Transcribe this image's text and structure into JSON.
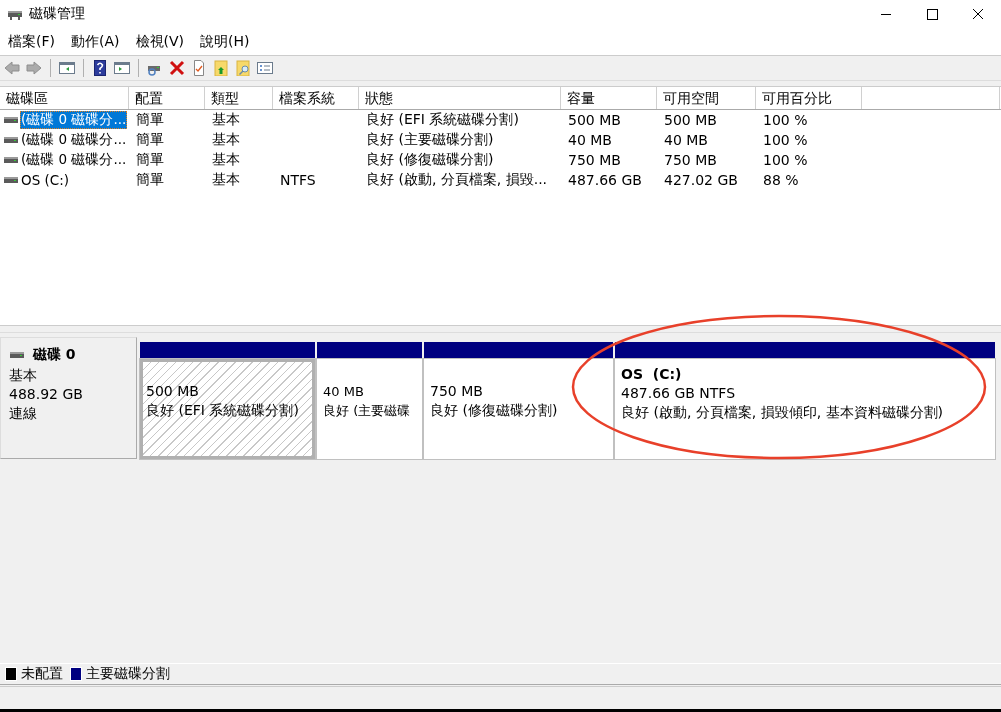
{
  "window": {
    "title": "磁碟管理"
  },
  "menu": [
    "檔案(F)",
    "動作(A)",
    "檢視(V)",
    "說明(H)"
  ],
  "toolbar": [
    {
      "kind": "back",
      "disabled": true
    },
    {
      "kind": "forward",
      "disabled": true
    },
    {
      "kind": "separator"
    },
    {
      "kind": "tree",
      "disabled": false
    },
    {
      "kind": "separator"
    },
    {
      "kind": "help",
      "disabled": false
    },
    {
      "kind": "pane",
      "disabled": false
    },
    {
      "kind": "separator"
    },
    {
      "kind": "drive",
      "disabled": false
    },
    {
      "kind": "delete",
      "disabled": false
    },
    {
      "kind": "properties",
      "disabled": false
    },
    {
      "kind": "folder_up",
      "disabled": false
    },
    {
      "kind": "folder_search",
      "disabled": false
    },
    {
      "kind": "checklist",
      "disabled": false
    }
  ],
  "table": {
    "columns": [
      "磁碟區",
      "配置",
      "類型",
      "檔案系統",
      "狀態",
      "容量",
      "可用空間",
      "可用百分比"
    ],
    "rows": [
      {
        "selected": true,
        "cells": [
          "(磁碟 0 磁碟分...",
          "簡單",
          "基本",
          "",
          "良好 (EFI 系統磁碟分割)",
          "500 MB",
          "500 MB",
          "100 %"
        ]
      },
      {
        "selected": false,
        "cells": [
          "(磁碟 0 磁碟分...",
          "簡單",
          "基本",
          "",
          "良好 (主要磁碟分割)",
          "40 MB",
          "40 MB",
          "100 %"
        ]
      },
      {
        "selected": false,
        "cells": [
          "(磁碟 0 磁碟分...",
          "簡單",
          "基本",
          "",
          "良好 (修復磁碟分割)",
          "750 MB",
          "750 MB",
          "100 %"
        ]
      },
      {
        "selected": false,
        "cells": [
          "OS (C:)",
          "簡單",
          "基本",
          "NTFS",
          "良好 (啟動, 分頁檔案, 損毀...",
          "487.66 GB",
          "427.02 GB",
          "88 %"
        ]
      }
    ]
  },
  "disk": {
    "name": "磁碟 0",
    "type": "基本",
    "size": "488.92 GB",
    "state": "連線",
    "partitions": [
      {
        "selected": true,
        "size": "500 MB",
        "status": "良好 (EFI 系統磁碟分割)"
      },
      {
        "selected": false,
        "size": "40 MB",
        "status": "良好 (主要磁碟"
      },
      {
        "selected": false,
        "size": "750 MB",
        "status": "良好 (修復磁碟分割)"
      },
      {
        "selected": false,
        "name": "OS  (C:)",
        "size": "487.66 GB NTFS",
        "status": "良好 (啟動, 分頁檔案, 損毀傾印, 基本資料磁碟分割)",
        "highlighted": true
      }
    ]
  },
  "legend": [
    {
      "label": "未配置",
      "color": "#000000"
    },
    {
      "label": "主要磁碟分割",
      "color": "#000080"
    }
  ]
}
